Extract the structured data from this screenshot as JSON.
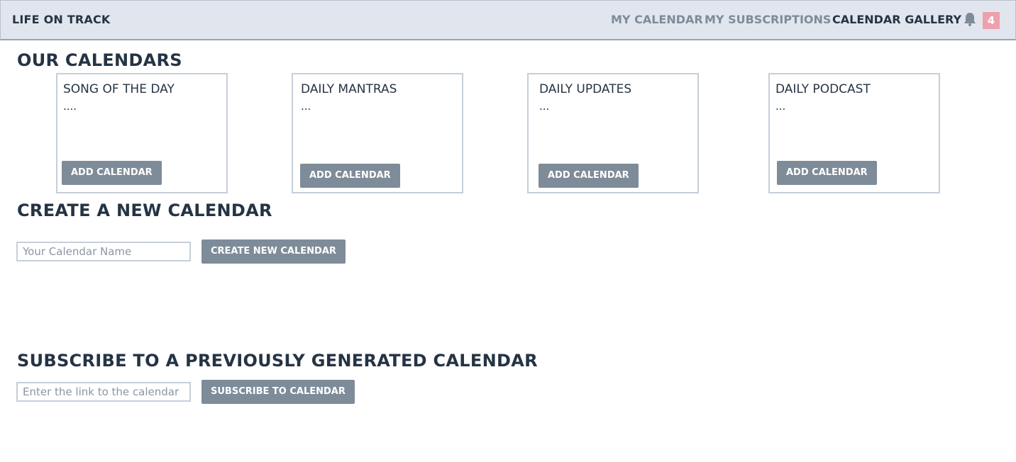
{
  "navbar": {
    "brand": "LIFE ON TRACK",
    "links": [
      {
        "label": "MY CALENDAR",
        "active": false
      },
      {
        "label": "MY SUBSCRIPTIONS",
        "active": false
      },
      {
        "label": "CALENDAR GALLERY",
        "active": true
      }
    ],
    "bell_icon": "bell-icon",
    "notification_count": "4",
    "badge_color": "#eda1ac"
  },
  "our_calendars": {
    "title": "OUR CALENDARS",
    "cards": [
      {
        "title": "SONG OF THE DAY",
        "description": "....",
        "button_label": "ADD CALENDAR"
      },
      {
        "title": "DAILY MANTRAS",
        "description": "...",
        "button_label": "ADD CALENDAR"
      },
      {
        "title": "DAILY UPDATES",
        "description": "...",
        "button_label": "ADD CALENDAR"
      },
      {
        "title": "DAILY PODCAST",
        "description": "...",
        "button_label": "ADD CALENDAR"
      }
    ]
  },
  "create_calendar": {
    "title": "CREATE A NEW CALENDAR",
    "input_placeholder": "Your Calendar Name",
    "input_value": "",
    "button_label": "CREATE NEW CALENDAR"
  },
  "subscribe_calendar": {
    "title": "SUBSCRIBE TO A PREVIOUSLY GENERATED CALENDAR",
    "input_placeholder": "Enter the link to the calendar",
    "input_value": "",
    "button_label": "SUBSCRIBE TO CALENDAR"
  },
  "colors": {
    "navbar_bg": "#e1e6ee",
    "text_dark": "#253444",
    "button_bg": "#7e8b99",
    "border": "#c6cfd9"
  }
}
